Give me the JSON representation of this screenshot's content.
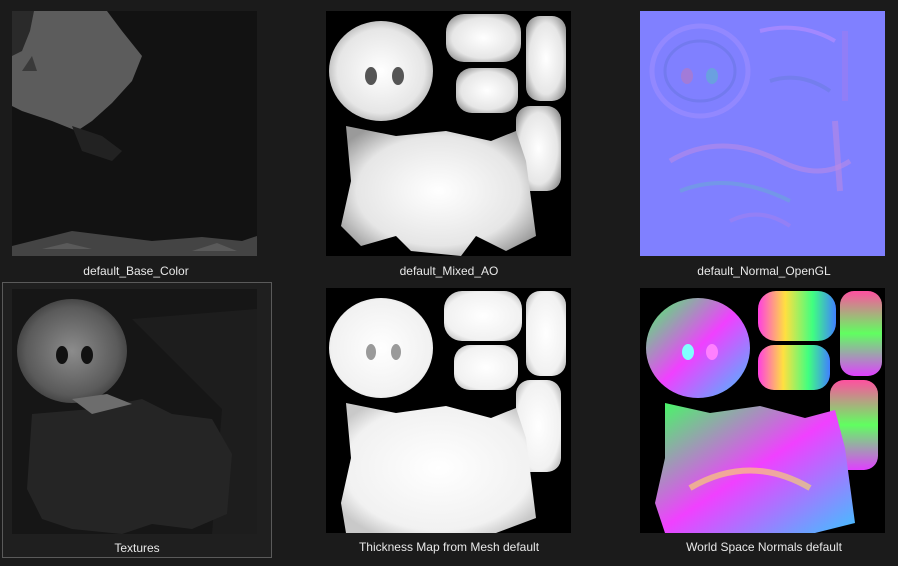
{
  "browser": {
    "items": [
      {
        "label": "default_Base_Color",
        "thumbnail": "base-color-map",
        "selected": false
      },
      {
        "label": "default_Mixed_AO",
        "thumbnail": "ambient-occlusion-map",
        "selected": false
      },
      {
        "label": "default_Normal_OpenGL",
        "thumbnail": "normal-map",
        "selected": false
      },
      {
        "label": "Textures",
        "thumbnail": "textures-preview",
        "selected": true
      },
      {
        "label": "Thickness Map from Mesh default",
        "thumbnail": "thickness-map",
        "selected": false
      },
      {
        "label": "World Space Normals default",
        "thumbnail": "world-space-normal-map",
        "selected": false
      }
    ]
  },
  "colors": {
    "background": "#1b1b1b",
    "selection_border": "#5a5a5a",
    "normal_base": "#8080ff",
    "caption_text": "#e8e8e8"
  }
}
